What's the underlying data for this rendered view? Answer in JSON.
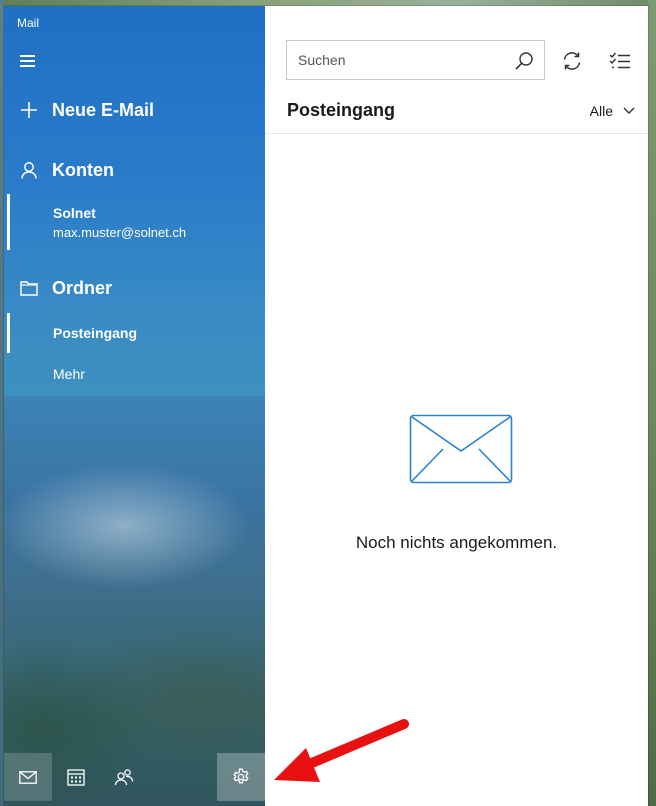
{
  "window": {
    "app_title": "Mail"
  },
  "sidebar": {
    "new_mail_label": "Neue E-Mail",
    "accounts_label": "Konten",
    "account": {
      "name": "Solnet",
      "email": "max.muster@solnet.ch"
    },
    "folders_label": "Ordner",
    "folders": [
      {
        "label": "Posteingang",
        "selected": true
      },
      {
        "label": "Mehr",
        "selected": false
      }
    ]
  },
  "bottom_nav": {
    "icons": [
      "mail-icon",
      "calendar-icon",
      "people-icon",
      "settings-icon"
    ],
    "active": "mail-icon"
  },
  "main": {
    "search": {
      "placeholder": "Suchen",
      "value": ""
    },
    "inbox_title": "Posteingang",
    "filter_label": "Alle",
    "empty_message": "Noch nichts angekommen."
  },
  "annotation": {
    "arrow_color": "#e81010",
    "points_to": "settings-button"
  },
  "colors": {
    "accent": "#1f6fc4",
    "outline_icon": "#2a82d0"
  }
}
